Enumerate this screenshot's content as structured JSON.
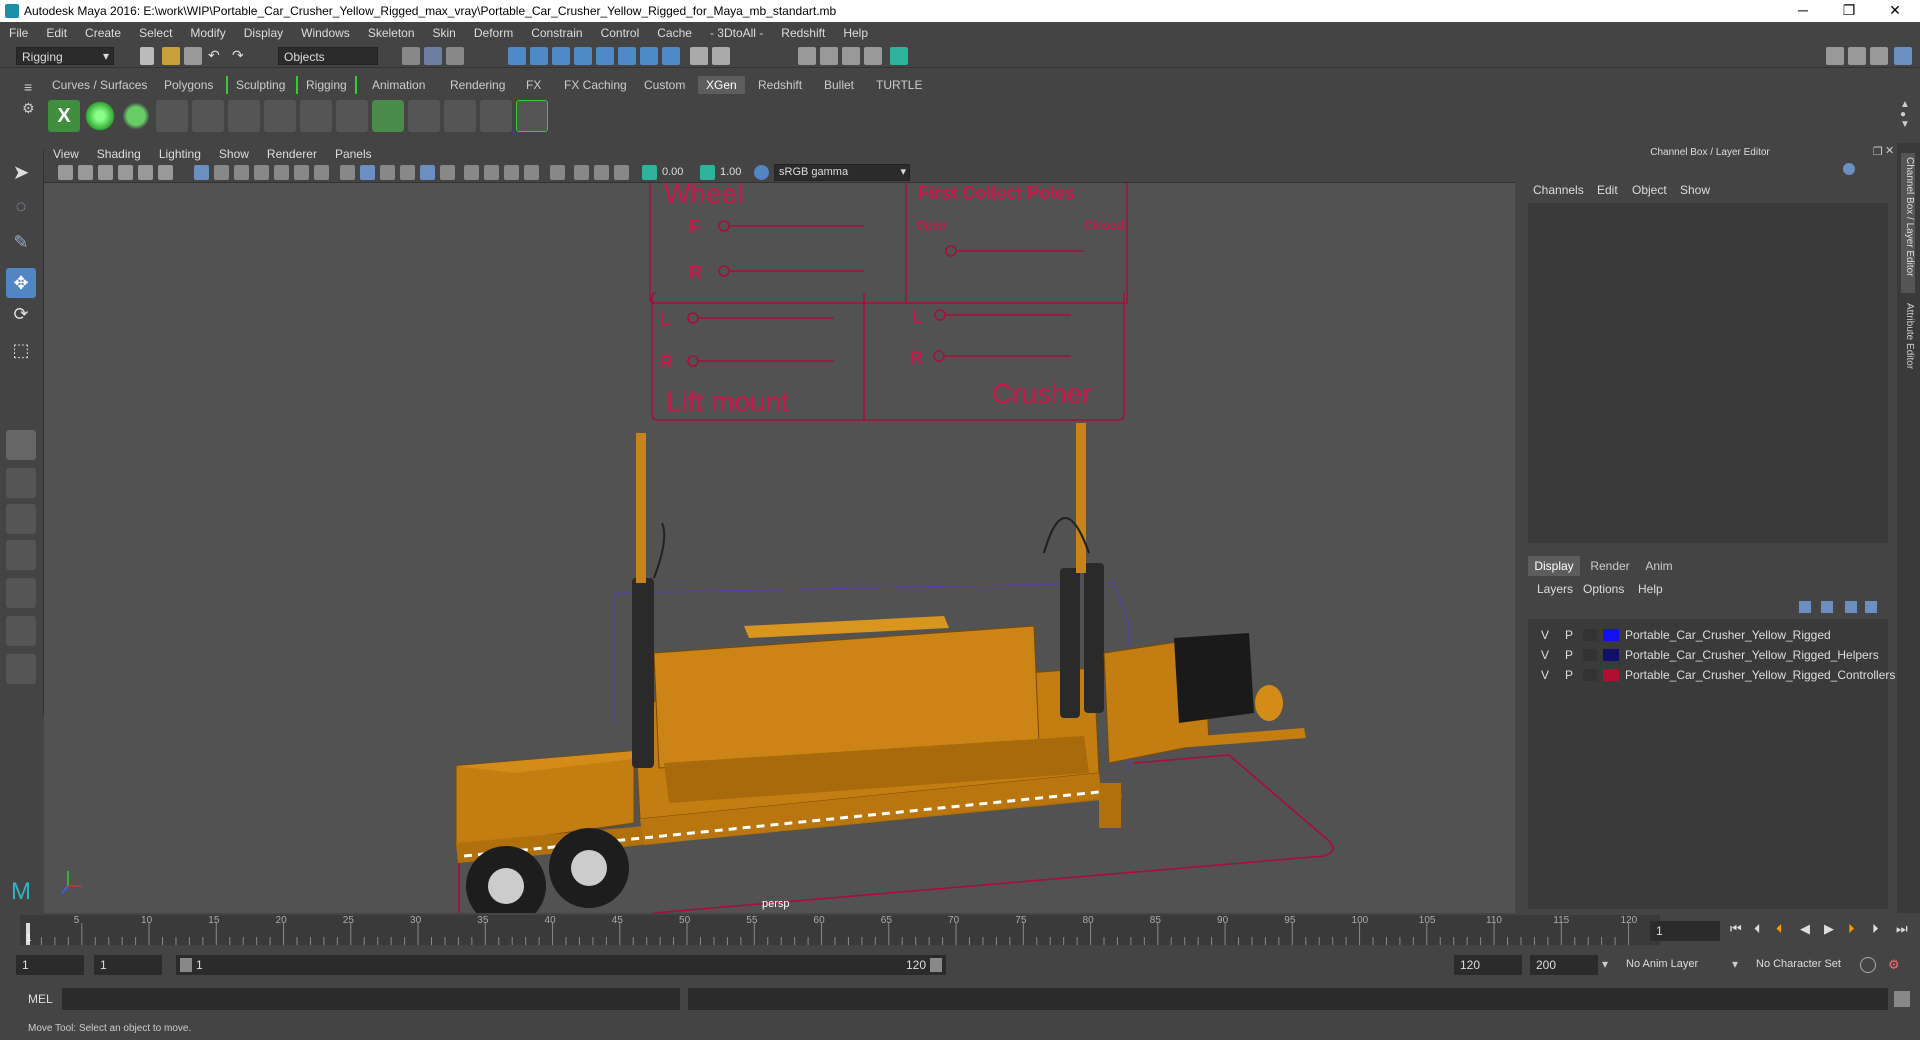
{
  "window": {
    "title": "Autodesk Maya 2016: E:\\work\\WIP\\Portable_Car_Crusher_Yellow_Rigged_max_vray\\Portable_Car_Crusher_Yellow_Rigged_for_Maya_mb_standart.mb",
    "min": "─",
    "max": "❐",
    "close": "✕"
  },
  "menu": [
    "File",
    "Edit",
    "Create",
    "Select",
    "Modify",
    "Display",
    "Windows",
    "Skeleton",
    "Skin",
    "Deform",
    "Constrain",
    "Control",
    "Cache",
    "- 3DtoAll -",
    "Redshift",
    "Help"
  ],
  "status": {
    "mode": "Rigging",
    "objects": "Objects"
  },
  "shelf_tabs": [
    "Curves / Surfaces",
    "Polygons",
    "Sculpting",
    "Rigging",
    "Animation",
    "Rendering",
    "FX",
    "FX Caching",
    "Custom",
    "XGen",
    "Redshift",
    "Bullet",
    "TURTLE"
  ],
  "shelf_active": "XGen",
  "viewport": {
    "menu": [
      "View",
      "Shading",
      "Lighting",
      "Show",
      "Renderer",
      "Panels"
    ],
    "near": "0.00",
    "far": "1.00",
    "colorspace": "sRGB gamma",
    "camera": "persp",
    "controls": {
      "wheel": "Wheel",
      "f": "F",
      "r": "R",
      "first": "First Collect Poles",
      "open": "Open",
      "closed": "Closed",
      "l1": "L",
      "r1": "R",
      "lift": "Lift mount",
      "l2": "L",
      "r2": "R",
      "crusher": "Crusher"
    }
  },
  "channel_box": {
    "title": "Channel Box / Layer Editor",
    "menu": [
      "Channels",
      "Edit",
      "Object",
      "Show"
    ]
  },
  "layer_editor": {
    "tabs": [
      "Display",
      "Render",
      "Anim"
    ],
    "active": "Display",
    "menu": [
      "Layers",
      "Options",
      "Help"
    ],
    "layers": [
      {
        "v": "V",
        "p": "P",
        "name": "Portable_Car_Crusher_Yellow_Rigged",
        "color": "#1010f0"
      },
      {
        "v": "V",
        "p": "P",
        "name": "Portable_Car_Crusher_Yellow_Rigged_Helpers",
        "color": "#10106a"
      },
      {
        "v": "V",
        "p": "P",
        "name": "Portable_Car_Crusher_Yellow_Rigged_Controllers",
        "color": "#b01030"
      }
    ]
  },
  "side_tabs": {
    "channel": "Channel Box / Layer Editor",
    "attr": "Attribute Editor"
  },
  "timeline": {
    "ticks": [
      "5",
      "10",
      "15",
      "20",
      "25",
      "30",
      "35",
      "40",
      "45",
      "50",
      "55",
      "60",
      "65",
      "70",
      "75",
      "80",
      "85",
      "90",
      "95",
      "100",
      "105",
      "110",
      "115",
      "120"
    ],
    "current": "1",
    "frame_field": "1"
  },
  "range": {
    "start": "1",
    "start2": "1",
    "slider_start": "1",
    "slider_end": "120",
    "end": "120",
    "end2": "200",
    "anim_layer": "No Anim Layer",
    "char_set": "No Character Set"
  },
  "cmd": {
    "label": "MEL"
  },
  "help": "Move Tool: Select an object to move."
}
